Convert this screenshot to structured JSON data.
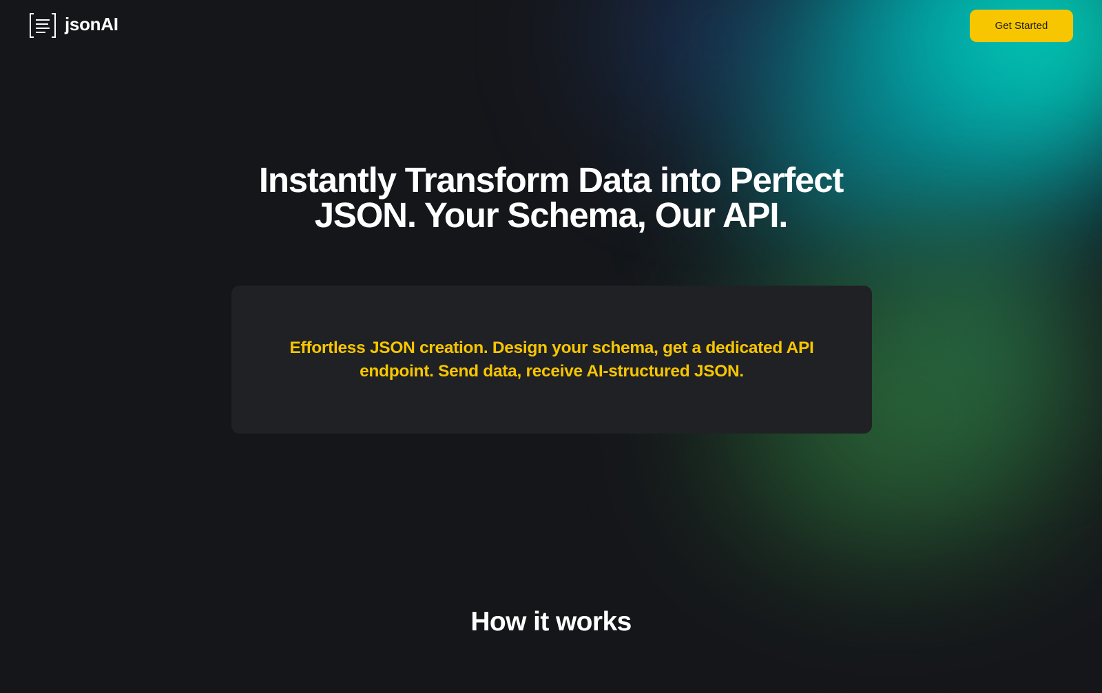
{
  "header": {
    "logo_icon": "json-brackets-lines-icon",
    "logo_text": "jsonAI",
    "cta_label": "Get Started"
  },
  "hero": {
    "title": "Instantly Transform Data into Perfect JSON. Your Schema, Our API.",
    "card_text": "Effortless JSON creation. Design your schema, get a dedicated API endpoint. Send data, receive AI-structured JSON."
  },
  "how_it_works": {
    "title": "How it works"
  },
  "colors": {
    "background": "#15161a",
    "accent_yellow": "#f7c600",
    "card_background": "#202124",
    "gradient_teal": "#00c9b8",
    "gradient_mint": "#00f0c4",
    "gradient_navy": "#1d3d70",
    "gradient_green": "#2f6a3c"
  }
}
